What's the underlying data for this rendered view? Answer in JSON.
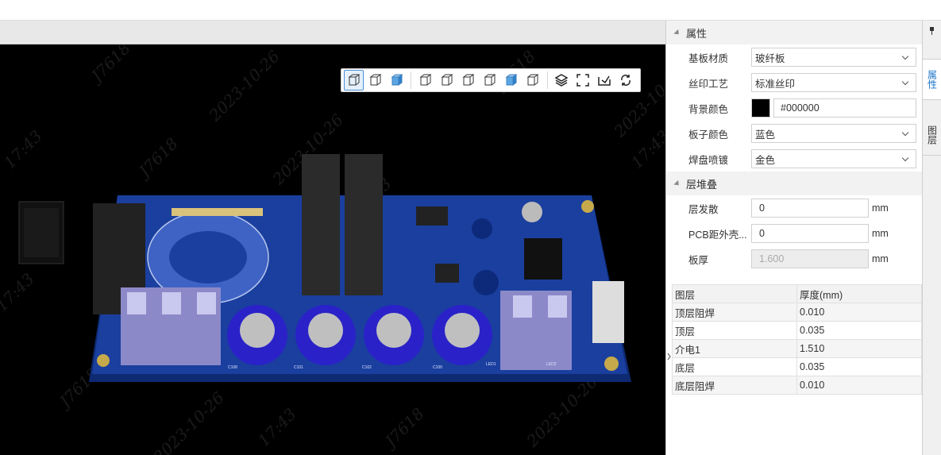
{
  "viewer": {
    "watermark_texts": [
      "J7618",
      "2023-10-26",
      "17:43"
    ],
    "toolbar": [
      {
        "icon": "view-3d-solid-icon",
        "active": true
      },
      {
        "icon": "view-3d-wire-icon",
        "active": false
      },
      {
        "icon": "view-3d-shaded-icon",
        "active": false
      },
      {
        "icon": "view-front-icon",
        "active": false
      },
      {
        "icon": "view-back-icon",
        "active": false
      },
      {
        "icon": "view-left-icon",
        "active": false
      },
      {
        "icon": "view-right-icon",
        "active": false
      },
      {
        "icon": "view-top-icon",
        "active": false
      },
      {
        "icon": "view-bottom-icon",
        "active": false
      },
      {
        "icon": "layers-icon",
        "active": false
      },
      {
        "icon": "fullscreen-icon",
        "active": false
      },
      {
        "icon": "export-icon",
        "active": false
      },
      {
        "icon": "reset-rotate-icon",
        "active": false
      }
    ],
    "board_labels": [
      "C108",
      "C101",
      "C102",
      "C100",
      "LED1",
      "LED2"
    ],
    "colors": {
      "background": "#000000",
      "board": "#1a3f9e",
      "capacitor": "#2a22c8",
      "terminal": "#8c89c9"
    }
  },
  "properties": {
    "section_title": "属性",
    "substrate_label": "基板材质",
    "substrate_value": "玻纤板",
    "silk_label": "丝印工艺",
    "silk_value": "标准丝印",
    "bg_color_label": "背景颜色",
    "bg_color_value": "#000000",
    "board_color_label": "板子颜色",
    "board_color_value": "蓝色",
    "pad_plating_label": "焊盘喷镀",
    "pad_plating_value": "金色"
  },
  "stackup": {
    "section_title": "层堆叠",
    "layer_spread_label": "层发散",
    "layer_spread_value": "0",
    "pcb_distance_label": "PCB距外壳...",
    "pcb_distance_value": "0",
    "thickness_label": "板厚",
    "thickness_value": "1.600",
    "unit": "mm"
  },
  "layer_table": {
    "headers": [
      "图层",
      "厚度(mm)"
    ],
    "rows": [
      [
        "顶层阻焊",
        "0.010"
      ],
      [
        "顶层",
        "0.035"
      ],
      [
        "介电1",
        "1.510"
      ],
      [
        "底层",
        "0.035"
      ],
      [
        "底层阻焊",
        "0.010"
      ]
    ]
  },
  "side_tabs": {
    "properties": "属性",
    "layers": "图层"
  }
}
